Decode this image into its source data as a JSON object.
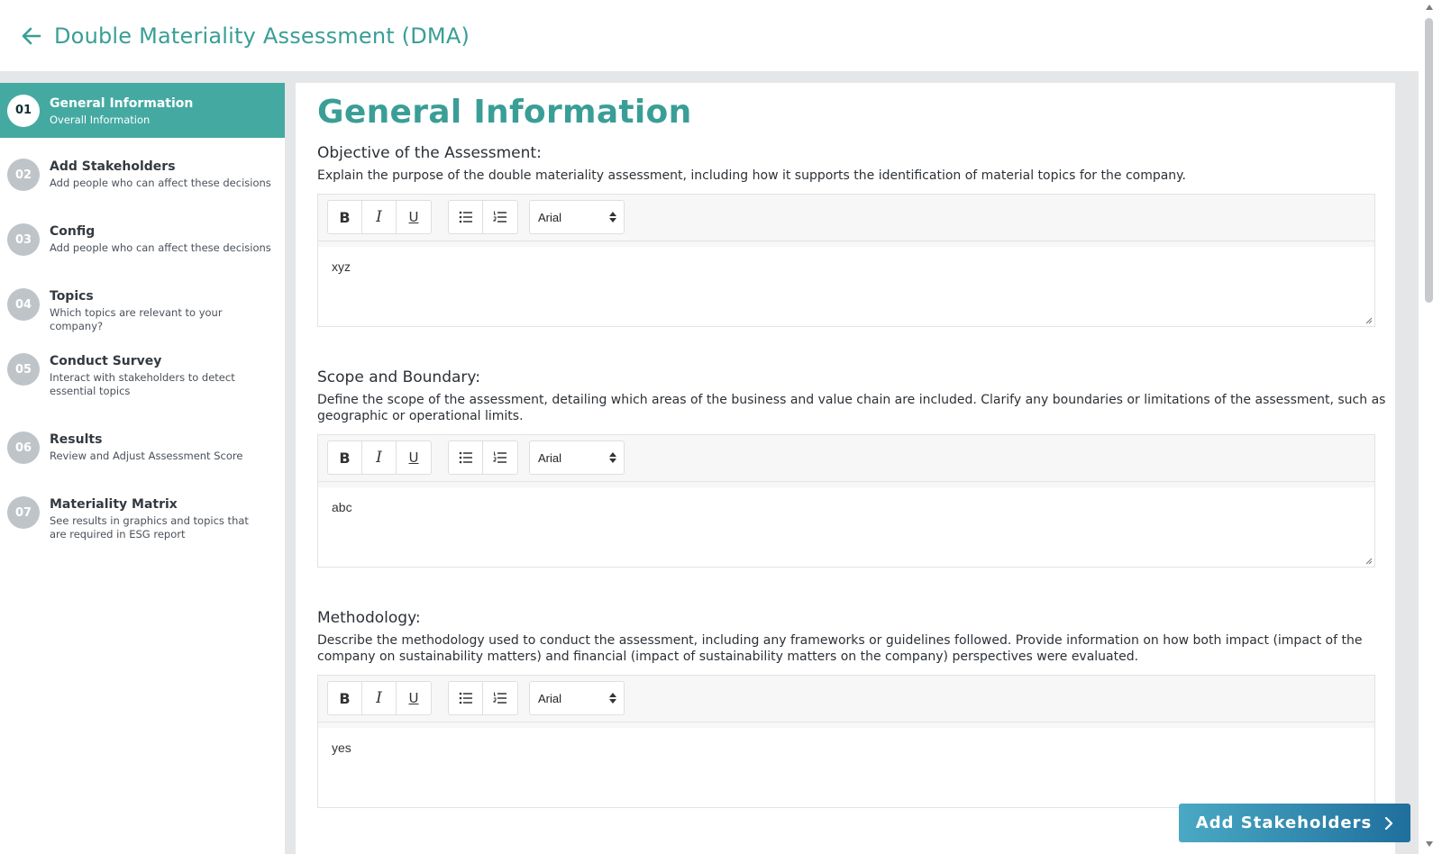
{
  "header": {
    "title": "Double Materiality Assessment (DMA)",
    "back_icon": "arrow-left-icon"
  },
  "colors": {
    "accent": "#3a9e97",
    "active_step": "#44aaa1",
    "button_start": "#4aa9c4",
    "button_end": "#1f6f9d"
  },
  "steps": [
    {
      "num": "01",
      "title": "General Information",
      "subtitle": "Overall Information",
      "active": true
    },
    {
      "num": "02",
      "title": "Add Stakeholders",
      "subtitle": "Add people who can affect these decisions",
      "active": false
    },
    {
      "num": "03",
      "title": "Config",
      "subtitle": "Add people who can affect these decisions",
      "active": false
    },
    {
      "num": "04",
      "title": "Topics",
      "subtitle": "Which topics are relevant to your company?",
      "active": false
    },
    {
      "num": "05",
      "title": "Conduct Survey",
      "subtitle": "Interact with stakeholders to detect essential topics",
      "active": false
    },
    {
      "num": "06",
      "title": "Results",
      "subtitle": "Review and Adjust Assessment Score",
      "active": false
    },
    {
      "num": "07",
      "title": "Materiality Matrix",
      "subtitle": "See results in graphics and topics that are required in ESG report",
      "active": false
    }
  ],
  "main": {
    "title": "General Information",
    "sections": [
      {
        "label": "Objective of the Assessment:",
        "description": "Explain the purpose of the double materiality assessment, including how it supports the identification of material topics for the company.",
        "font": "Arial",
        "value": "xyz"
      },
      {
        "label": "Scope and Boundary:",
        "description": "Define the scope of the assessment, detailing which areas of the business and value chain are included. Clarify any boundaries or limitations of the assessment, such as geographic or operational limits.",
        "font": "Arial",
        "value": "abc"
      },
      {
        "label": "Methodology:",
        "description": "Describe the methodology used to conduct the assessment, including any frameworks or guidelines followed. Provide information on how both impact (impact of the company on sustainability matters) and financial (impact of sustainability matters on the company) perspectives were evaluated.",
        "font": "Arial",
        "value": "yes"
      }
    ],
    "toolbar": {
      "bold": "B",
      "italic": "I",
      "underline": "U",
      "bullet_icon": "bulleted-list-icon",
      "numbered_icon": "numbered-list-icon"
    }
  },
  "next_button": {
    "label": "Add Stakeholders",
    "icon": "chevron-right-icon"
  }
}
